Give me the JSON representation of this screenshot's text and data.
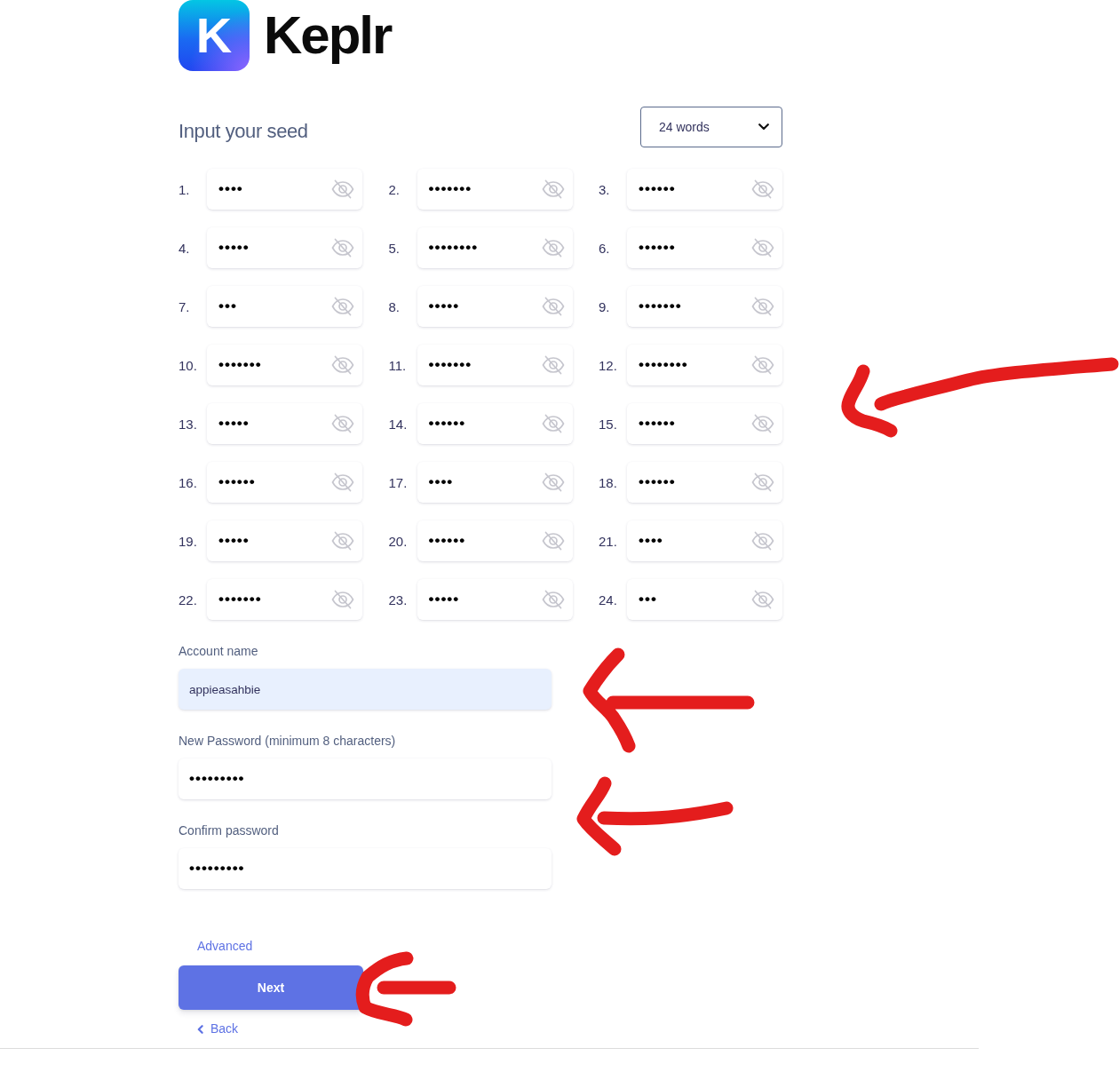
{
  "logo": {
    "letter": "K",
    "name": "Keplr"
  },
  "seed": {
    "title": "Input your seed",
    "word_count": "24 words",
    "words": [
      {
        "number": "1.",
        "value": "••••",
        "hidden": true
      },
      {
        "number": "2.",
        "value": "•••••••",
        "hidden": true
      },
      {
        "number": "3.",
        "value": "••••••",
        "hidden": true
      },
      {
        "number": "4.",
        "value": "•••••",
        "hidden": true
      },
      {
        "number": "5.",
        "value": "••••••••",
        "hidden": true
      },
      {
        "number": "6.",
        "value": "••••••",
        "hidden": true
      },
      {
        "number": "7.",
        "value": "•••",
        "hidden": true
      },
      {
        "number": "8.",
        "value": "•••••",
        "hidden": true
      },
      {
        "number": "9.",
        "value": "•••••••",
        "hidden": true
      },
      {
        "number": "10.",
        "value": "•••••••",
        "hidden": true
      },
      {
        "number": "11.",
        "value": "•••••••",
        "hidden": true
      },
      {
        "number": "12.",
        "value": "••••••••",
        "hidden": true
      },
      {
        "number": "13.",
        "value": "•••••",
        "hidden": true
      },
      {
        "number": "14.",
        "value": "••••••",
        "hidden": true
      },
      {
        "number": "15.",
        "value": "••••••",
        "hidden": true
      },
      {
        "number": "16.",
        "value": "••••••",
        "hidden": true
      },
      {
        "number": "17.",
        "value": "••••",
        "hidden": true
      },
      {
        "number": "18.",
        "value": "••••••",
        "hidden": true
      },
      {
        "number": "19.",
        "value": "•••••",
        "hidden": true
      },
      {
        "number": "20.",
        "value": "••••••",
        "hidden": true
      },
      {
        "number": "21.",
        "value": "••••",
        "hidden": true
      },
      {
        "number": "22.",
        "value": "•••••••",
        "hidden": true
      },
      {
        "number": "23.",
        "value": "•••••",
        "hidden": true
      },
      {
        "number": "24.",
        "value": "•••",
        "hidden": true
      }
    ]
  },
  "form_fields": [
    {
      "kind": "text",
      "label": "Account name",
      "value": "appieasahbie",
      "autofilled": true
    },
    {
      "kind": "password",
      "label": "New Password (minimum 8 characters)",
      "value": "•••••••••",
      "autofilled": false
    },
    {
      "kind": "password",
      "label": "Confirm password",
      "value": "•••••••••",
      "autofilled": false
    }
  ],
  "advanced_link": "Advanced",
  "next_button": "Next",
  "back_link": "Back"
}
